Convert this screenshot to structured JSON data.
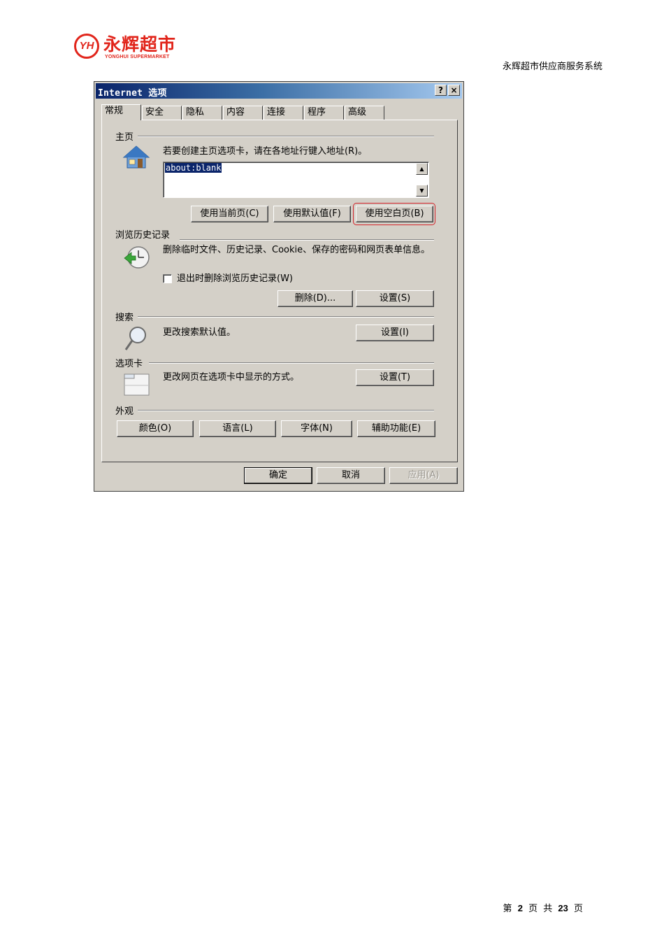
{
  "page": {
    "logo": {
      "mark": "YH",
      "name_cn": "永辉超市",
      "name_en": "YONGHUI SUPERMARKET"
    },
    "header_title": "永辉超市供应商服务系统",
    "footer": {
      "prefix": "第",
      "page": "2",
      "page_unit": "页",
      "total_prefix": "共",
      "total": "23",
      "total_unit": "页"
    }
  },
  "dialog": {
    "title": "Internet 选项",
    "help_label": "?",
    "close_label": "×",
    "tabs": [
      "常规",
      "安全",
      "隐私",
      "内容",
      "连接",
      "程序",
      "高级"
    ],
    "active_tab": "常规",
    "homepage": {
      "group_label": "主页",
      "instruction": "若要创建主页选项卡，请在各地址行键入地址(R)。",
      "value": "about:blank",
      "buttons": {
        "use_current": "使用当前页(C)",
        "use_default": "使用默认值(F)",
        "use_blank": "使用空白页(B)"
      }
    },
    "history": {
      "group_label": "浏览历史记录",
      "description": "删除临时文件、历史记录、Cookie、保存的密码和网页表单信息。",
      "checkbox_label": "退出时删除浏览历史记录(W)",
      "checkbox_checked": false,
      "buttons": {
        "delete": "删除(D)...",
        "settings": "设置(S)"
      }
    },
    "search": {
      "group_label": "搜索",
      "description": "更改搜索默认值。",
      "settings": "设置(I)"
    },
    "tabs_section": {
      "group_label": "选项卡",
      "description": "更改网页在选项卡中显示的方式。",
      "settings": "设置(T)"
    },
    "appearance": {
      "group_label": "外观",
      "buttons": {
        "colors": "颜色(O)",
        "languages": "语言(L)",
        "fonts": "字体(N)",
        "accessibility": "辅助功能(E)"
      }
    },
    "footer_buttons": {
      "ok": "确定",
      "cancel": "取消",
      "apply": "应用(A)"
    },
    "colors": {
      "highlight": "#d2232a",
      "titlebar": "#0a246a",
      "face": "#d4d0c8"
    }
  }
}
